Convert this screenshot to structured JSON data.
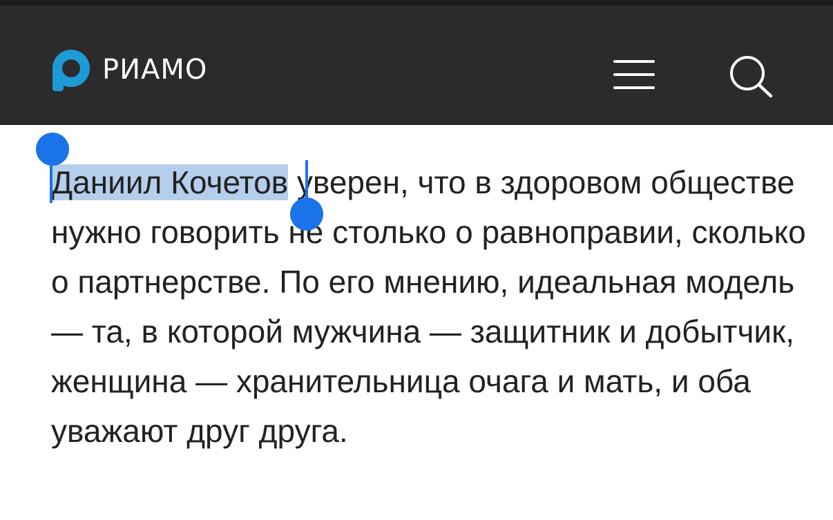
{
  "header": {
    "logo_text": "РИАМО",
    "brand_color": "#1e9ad6",
    "background": "#2b2b2b",
    "icons": [
      "menu-icon",
      "search-icon"
    ]
  },
  "article": {
    "selected_text": "Даниил Кочетов",
    "paragraph_rest": " уверен, что в здоровом обществе нужно говорить не столько о равноправии, сколько о партнерстве. По его мнению, идеальная модель — та, в которой мужчина — защитник и добытчик, женщина — хранительница очага и мать, и оба уважают друг друга."
  },
  "selection": {
    "highlight_color": "#78a5da",
    "handle_color": "#1a73e8"
  }
}
